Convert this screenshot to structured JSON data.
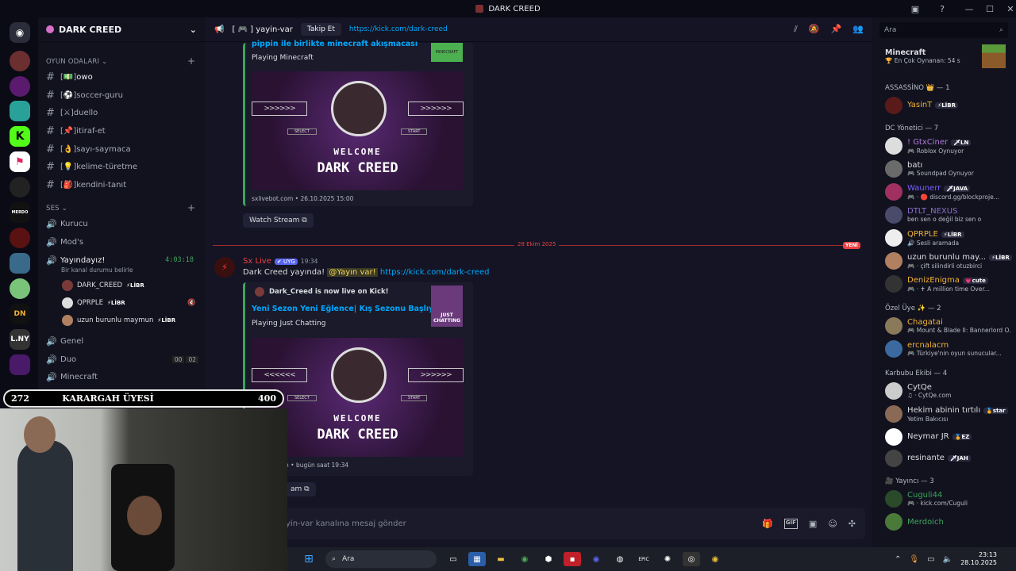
{
  "window": {
    "title": "DARK CREED",
    "help": "?",
    "min": "—",
    "max": "☐",
    "close": "✕"
  },
  "server": {
    "name": "DARK CREED",
    "chevron": "⌄"
  },
  "channels": {
    "cat_text": "OYUN ODALARI ⌄",
    "cat_voice": "SES ⌄",
    "add": "+",
    "text": [
      {
        "label": "owo",
        "emoji": "💵"
      },
      {
        "label": "soccer-guru",
        "emoji": "⚽"
      },
      {
        "label": "duello",
        "emoji": "⚔"
      },
      {
        "label": "itiraf-et",
        "emoji": "📌"
      },
      {
        "label": "sayı-saymaca",
        "emoji": "👌"
      },
      {
        "label": "kelime-türetme",
        "emoji": "💡"
      },
      {
        "label": "kendini-tanıt",
        "emoji": "🎒"
      }
    ],
    "voice": [
      {
        "label": "Kurucu"
      },
      {
        "label": "Mod's"
      },
      {
        "label": "Yayındayız!",
        "time": "4:03:18",
        "status": "Bir kanal durumu belirle"
      },
      {
        "label": "Genel"
      },
      {
        "label": "Duo",
        "count_a": "00",
        "count_b": "02"
      },
      {
        "label": "Minecraft"
      }
    ],
    "voice_users": [
      {
        "name": "DARK_CREED",
        "tag": "⚡LİBR",
        "color": "#dbdee1"
      },
      {
        "name": "QPRPLE",
        "tag": "⚡LİBR",
        "color": "#dbdee1"
      },
      {
        "name": "uzun burunlu maymun",
        "tag": "⚡LİBR",
        "color": "#dbdee1"
      }
    ]
  },
  "header": {
    "channel": "[ 🎮 ] yayin-var",
    "follow": "Takip Et",
    "link": "https://kick.com/dark-creed"
  },
  "messages": {
    "embed1": {
      "title": "pippin ile birlikte minecraft akışmacası",
      "playing": "Playing Minecraft",
      "footer": "sxlivebot.com • 26.10.2025 15:00",
      "thumb": "MINECRAFT"
    },
    "watch": "Watch Stream ⧉",
    "date_divider": "28 Ekim 2025",
    "new_badge": "YENİ",
    "author": "Sx Live",
    "author_badge": "✔ UYG",
    "time": "19:34",
    "text": "Dark Creed yayında!",
    "mention": "@Yayın var!",
    "link": "https://kick.com/dark-creed",
    "embed2": {
      "author": "Dark_Creed is now live on Kick!",
      "title": "Yeni Sezon Yeni Eğlence| Kış Sezonu Başlıyor",
      "playing": "Playing Just Chatting",
      "footer": "n • bugün saat 19:34",
      "thumb": "JUST CHATTING"
    },
    "watch2": "am ⧉",
    "banner": {
      "w1": "WELCOME",
      "w2": "DARK CREED",
      "select": "SELECT",
      "start": "START"
    }
  },
  "composer": {
    "placeholder": "yin-var kanalına mesaj gönder"
  },
  "overlay": {
    "left": "272",
    "center": "KARARGAH ÜYESİ",
    "right": "400"
  },
  "members": {
    "search": "Ara",
    "top": {
      "name": "Minecraft",
      "status": "🏆 En Çok Oynanan: 54 s"
    },
    "groups": [
      {
        "header": "ASSASSİNO 👑 — 1",
        "items": [
          {
            "name": "YasinT",
            "badge": "⚡LİBR",
            "status": "",
            "color": "#f0b232"
          }
        ]
      },
      {
        "header": "DC Yönetici — 7",
        "items": [
          {
            "name": "! GtxCiner",
            "badge": "🗡LN",
            "status": "🎮 Roblox Oynuyor",
            "color": "#b07ad6"
          },
          {
            "name": "batı",
            "badge": "",
            "status": "🎮 Soundpad Oynuyor",
            "color": "#dbdee1"
          },
          {
            "name": "Waunerr",
            "badge": "🗡JAVA",
            "status": "🎮 · 🔴 discord.gg/blockproje...",
            "color": "#7a5cff"
          },
          {
            "name": "DTLT_NEXUS",
            "badge": "",
            "status": "ben sen o değil biz sen o",
            "color": "#8a6fc8"
          },
          {
            "name": "QPRPLE",
            "badge": "⚡LİBR",
            "status": "🔊 Sesli aramada",
            "color": "#f0b232"
          },
          {
            "name": "uzun burunlu may...",
            "badge": "⚡LİBR",
            "status": "🎮 · çift silindirli otuzbirci",
            "color": "#dbdee1"
          },
          {
            "name": "DenizEnigma",
            "badge": "💗cute",
            "status": "🎮 · ✝ A million time Over...",
            "color": "#f0b232"
          }
        ]
      },
      {
        "header": "Özel Üye ✨ — 2",
        "items": [
          {
            "name": "Chagatai",
            "badge": "",
            "status": "🎮 Mount & Blade II: Bannerlord O...",
            "color": "#f0b232"
          },
          {
            "name": "ercnalacm",
            "badge": "",
            "status": "🎮 Türkiye'nin oyun sunucular...",
            "color": "#f0b232"
          }
        ]
      },
      {
        "header": "Karbubu Ekibi — 4",
        "items": [
          {
            "name": "CytQe",
            "badge": "",
            "status": "♫ · CytQe.com",
            "color": "#dbdee1"
          },
          {
            "name": "Hekim abinin tırtılı",
            "badge": "🏅star",
            "status": "Yetim Bakıcısı",
            "color": "#dbdee1"
          },
          {
            "name": "Neymar JR",
            "badge": "🏅EZ",
            "status": "",
            "color": "#dbdee1"
          },
          {
            "name": "resinante",
            "badge": "🗡JAH",
            "status": "",
            "color": "#dbdee1"
          }
        ]
      },
      {
        "header": "🎥 Yayıncı — 3",
        "items": [
          {
            "name": "Cuguli44",
            "badge": "",
            "status": "🎮 · kick.com/Cuguli",
            "color": "#3ba55d"
          },
          {
            "name": "Merdoich",
            "badge": "",
            "status": "",
            "color": "#3ba55d"
          }
        ]
      }
    ]
  },
  "taskbar": {
    "search": "Ara",
    "time": "23:13",
    "date": "28.10.2025"
  },
  "colors": {
    "accent": "#5865f2",
    "green": "#3ba55d",
    "red": "#ed4245"
  }
}
